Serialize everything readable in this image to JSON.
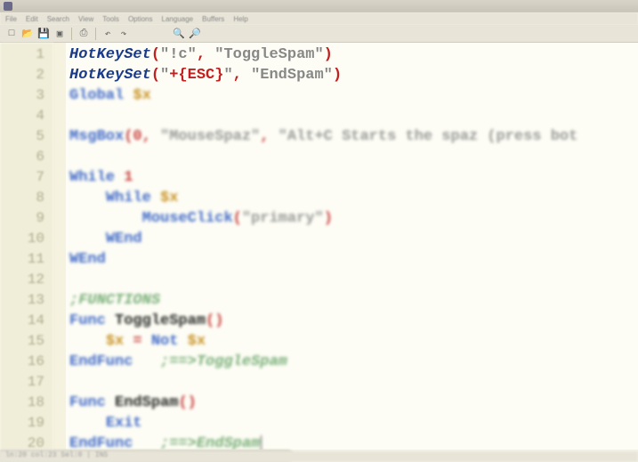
{
  "menubar": {
    "items": [
      "File",
      "Edit",
      "Search",
      "View",
      "Tools",
      "Options",
      "Language",
      "Buffers",
      "Help"
    ]
  },
  "toolbar": {
    "new": "□",
    "open": "📂",
    "save": "💾",
    "saveall": "▣",
    "print": "⎙",
    "undo": "↶",
    "redo": "↷",
    "zoom_in": "🔍",
    "zoom_out": "🔎"
  },
  "code": {
    "lines": [
      {
        "n": 1,
        "sharp": true,
        "seg": [
          {
            "c": "kw-func",
            "t": "HotKeySet"
          },
          {
            "c": "paren",
            "t": "("
          },
          {
            "c": "str-gray",
            "t": "\"!c\""
          },
          {
            "c": "paren",
            "t": ","
          },
          {
            "c": "",
            "t": " "
          },
          {
            "c": "str-gray",
            "t": "\"ToggleSpam\""
          },
          {
            "c": "paren",
            "t": ")"
          }
        ]
      },
      {
        "n": 2,
        "sharp": true,
        "seg": [
          {
            "c": "kw-func",
            "t": "HotKeySet"
          },
          {
            "c": "paren",
            "t": "("
          },
          {
            "c": "str-gray",
            "t": "\""
          },
          {
            "c": "str-esc",
            "t": "+{ESC}"
          },
          {
            "c": "str-gray",
            "t": "\""
          },
          {
            "c": "paren",
            "t": ","
          },
          {
            "c": "",
            "t": " "
          },
          {
            "c": "str-gray",
            "t": "\"EndSpam\""
          },
          {
            "c": "paren",
            "t": ")"
          }
        ]
      },
      {
        "n": 3,
        "seg": [
          {
            "c": "kw-blue",
            "t": "Global "
          },
          {
            "c": "var",
            "t": "$x"
          }
        ]
      },
      {
        "n": 4,
        "seg": []
      },
      {
        "n": 5,
        "seg": [
          {
            "c": "kw-blue",
            "t": "MsgBox"
          },
          {
            "c": "paren",
            "t": "("
          },
          {
            "c": "num",
            "t": "0"
          },
          {
            "c": "paren",
            "t": ","
          },
          {
            "c": "",
            "t": " "
          },
          {
            "c": "str-gray",
            "t": "\"MouseSpaz\""
          },
          {
            "c": "paren",
            "t": ","
          },
          {
            "c": "",
            "t": " "
          },
          {
            "c": "str-gray",
            "t": "\"Alt+C Starts the spaz (press bot"
          }
        ]
      },
      {
        "n": 6,
        "seg": []
      },
      {
        "n": 7,
        "seg": [
          {
            "c": "kw-blue",
            "t": "While "
          },
          {
            "c": "num",
            "t": "1"
          }
        ]
      },
      {
        "n": 8,
        "seg": [
          {
            "c": "",
            "t": "    "
          },
          {
            "c": "kw-blue",
            "t": "While "
          },
          {
            "c": "var",
            "t": "$x"
          }
        ]
      },
      {
        "n": 9,
        "seg": [
          {
            "c": "",
            "t": "        "
          },
          {
            "c": "kw-blue",
            "t": "MouseClick"
          },
          {
            "c": "paren",
            "t": "("
          },
          {
            "c": "str-gray",
            "t": "\"primary\""
          },
          {
            "c": "paren",
            "t": ")"
          }
        ]
      },
      {
        "n": 10,
        "seg": [
          {
            "c": "",
            "t": "    "
          },
          {
            "c": "kw-blue",
            "t": "WEnd"
          }
        ]
      },
      {
        "n": 11,
        "seg": [
          {
            "c": "kw-blue",
            "t": "WEnd"
          }
        ]
      },
      {
        "n": 12,
        "seg": []
      },
      {
        "n": 13,
        "seg": [
          {
            "c": "comment",
            "t": ";FUNCTIONS"
          }
        ]
      },
      {
        "n": 14,
        "seg": [
          {
            "c": "kw-blue",
            "t": "Func "
          },
          {
            "c": "",
            "t": "ToggleSpam"
          },
          {
            "c": "paren",
            "t": "()"
          }
        ]
      },
      {
        "n": 15,
        "seg": [
          {
            "c": "",
            "t": "    "
          },
          {
            "c": "var",
            "t": "$x"
          },
          {
            "c": "",
            "t": " "
          },
          {
            "c": "op",
            "t": "="
          },
          {
            "c": "",
            "t": " "
          },
          {
            "c": "kw-blue",
            "t": "Not "
          },
          {
            "c": "var",
            "t": "$x"
          }
        ]
      },
      {
        "n": 16,
        "seg": [
          {
            "c": "kw-blue",
            "t": "EndFunc"
          },
          {
            "c": "",
            "t": "   "
          },
          {
            "c": "comment",
            "t": ";==>ToggleSpam"
          }
        ]
      },
      {
        "n": 17,
        "seg": []
      },
      {
        "n": 18,
        "seg": [
          {
            "c": "kw-blue",
            "t": "Func "
          },
          {
            "c": "",
            "t": "EndSpam"
          },
          {
            "c": "paren",
            "t": "()"
          }
        ]
      },
      {
        "n": 19,
        "seg": [
          {
            "c": "",
            "t": "    "
          },
          {
            "c": "kw-blue",
            "t": "Exit"
          }
        ]
      },
      {
        "n": 20,
        "seg": [
          {
            "c": "kw-blue",
            "t": "EndFunc"
          },
          {
            "c": "",
            "t": "   "
          },
          {
            "c": "comment",
            "t": ";==>EndSpam"
          }
        ],
        "caret": true
      }
    ]
  },
  "statusbar": {
    "text": "ln:20 col:23 Sel:0 | INS"
  }
}
